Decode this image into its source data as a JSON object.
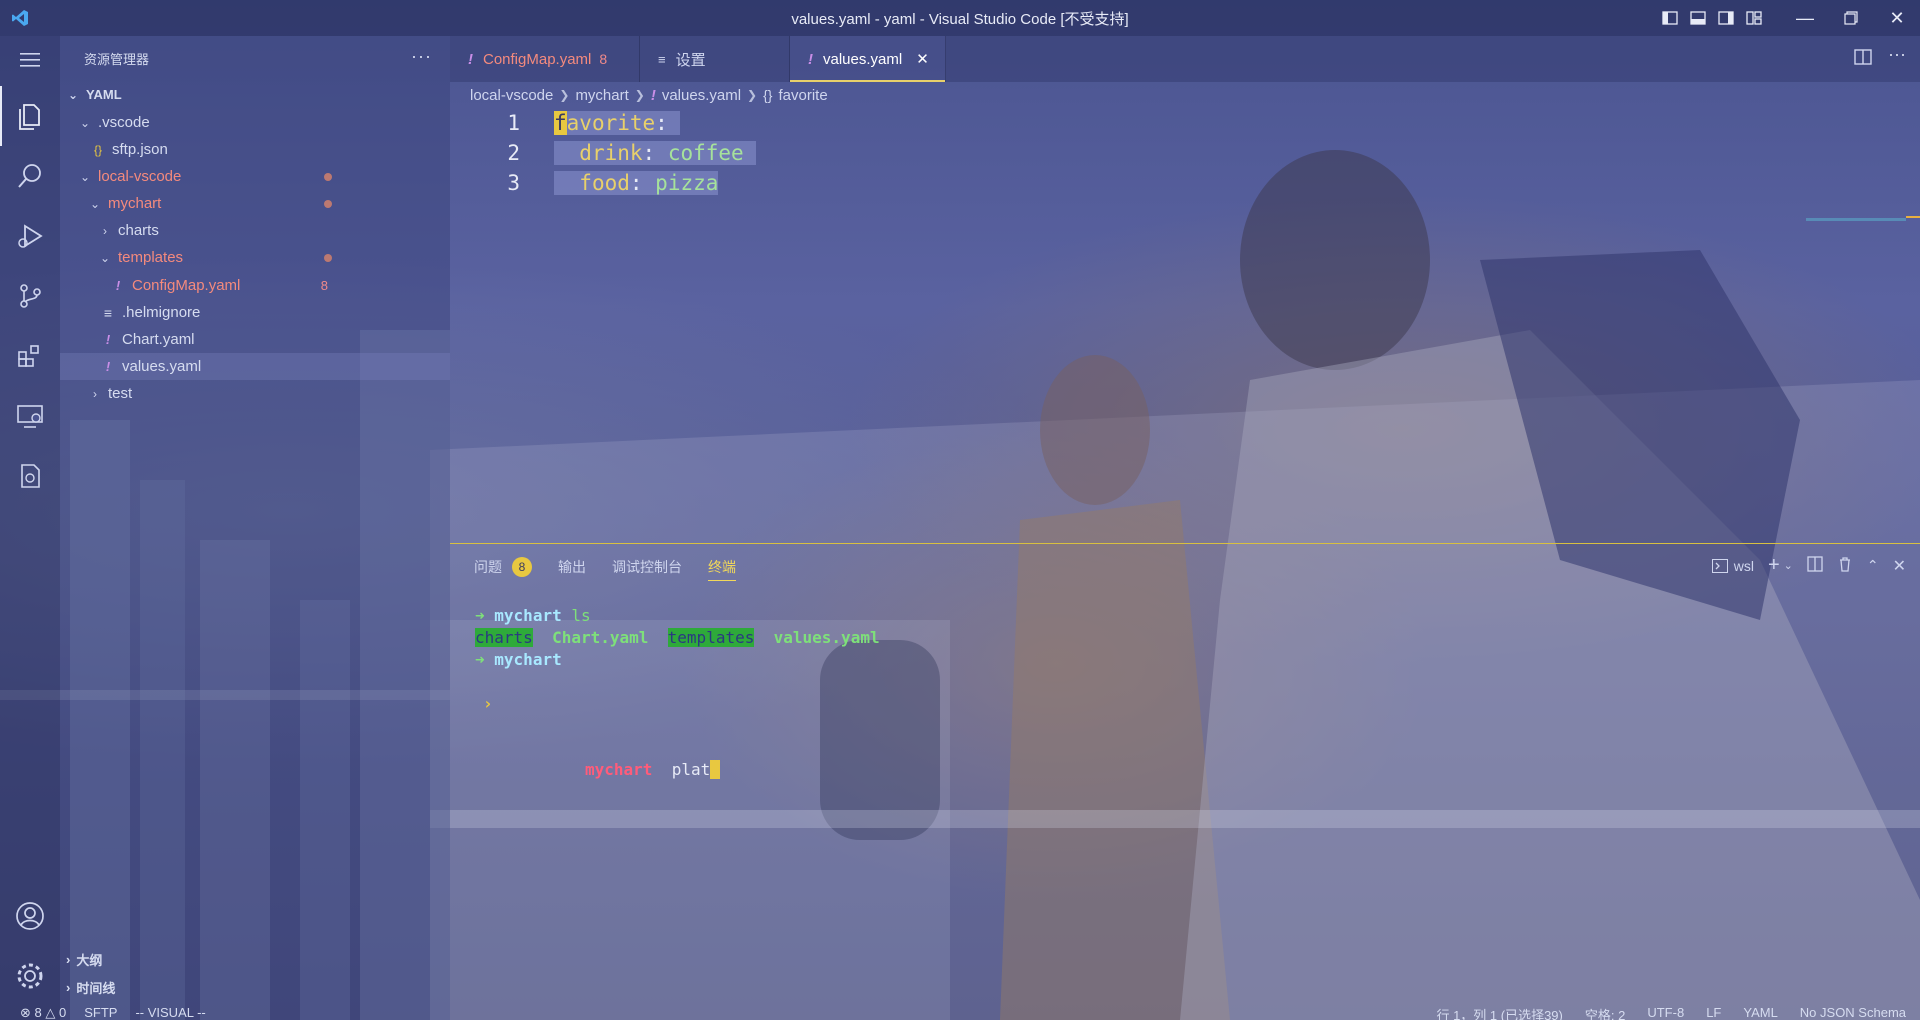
{
  "window": {
    "title": "values.yaml - yaml - Visual Studio Code [不受支持]"
  },
  "sidebar": {
    "header": "资源管理器",
    "root": "YAML",
    "items": [
      {
        "label": ".vscode",
        "kind": "folder",
        "depth": 1
      },
      {
        "label": "sftp.json",
        "kind": "json",
        "depth": 2
      },
      {
        "label": "local-vscode",
        "kind": "folder",
        "depth": 1
      },
      {
        "label": "mychart",
        "kind": "folder",
        "depth": 2
      },
      {
        "label": "charts",
        "kind": "folder",
        "depth": 3
      },
      {
        "label": "templates",
        "kind": "folder",
        "depth": 3
      },
      {
        "label": "ConfigMap.yaml",
        "kind": "yaml",
        "depth": 4,
        "count": "8"
      },
      {
        "label": ".helmignore",
        "kind": "text",
        "depth": 3
      },
      {
        "label": "Chart.yaml",
        "kind": "yaml",
        "depth": 3
      },
      {
        "label": "values.yaml",
        "kind": "yaml",
        "depth": 3
      },
      {
        "label": "test",
        "kind": "folder",
        "depth": 2
      }
    ],
    "bottom": {
      "outline": "大纲",
      "timeline": "时间线"
    }
  },
  "tabs": [
    {
      "label": "ConfigMap.yaml",
      "count": "8",
      "icon": "yaml-icon"
    },
    {
      "label": "设置",
      "icon": "settings-icon"
    },
    {
      "label": "values.yaml",
      "icon": "yaml-icon",
      "active": true
    }
  ],
  "breadcrumb": [
    "local-vscode",
    "mychart",
    "values.yaml",
    "favorite"
  ],
  "editor": {
    "lines": [
      {
        "num": "1",
        "key": "favorite",
        "value": ""
      },
      {
        "num": "2",
        "key": "drink",
        "value": "coffee"
      },
      {
        "num": "3",
        "key": "food",
        "value": "pizza"
      }
    ]
  },
  "panel": {
    "tabs": [
      {
        "label": "问题",
        "badge": "8"
      },
      {
        "label": "输出"
      },
      {
        "label": "调试控制台"
      },
      {
        "label": "终端",
        "active": true
      }
    ],
    "shell": "wsl",
    "terminal": {
      "line1": {
        "arrow": "➜",
        "dir": "mychart",
        "cmd": "ls"
      },
      "line2": [
        "charts",
        "Chart.yaml",
        "templates",
        "values.yaml"
      ],
      "line3": {
        "arrow": "➜",
        "dir": "mychart"
      },
      "prompt_symbol": "›",
      "suggest": {
        "dir": "mychart",
        "typed": "plat"
      }
    }
  },
  "statusbar": {
    "errors": "8",
    "warnings": "0",
    "sftp": "SFTP",
    "mode": "-- VISUAL --",
    "position": "行 1，列 1 (已选择39)",
    "spaces": "空格: 2",
    "encoding": "UTF-8",
    "eol": "LF",
    "language": "YAML",
    "schema": "No JSON Schema"
  },
  "colors": {
    "accent": "#e8d06a",
    "yaml_key": "#e8d06a",
    "yaml_value": "#a6e29b",
    "modified_folder": "#f48a7d"
  }
}
